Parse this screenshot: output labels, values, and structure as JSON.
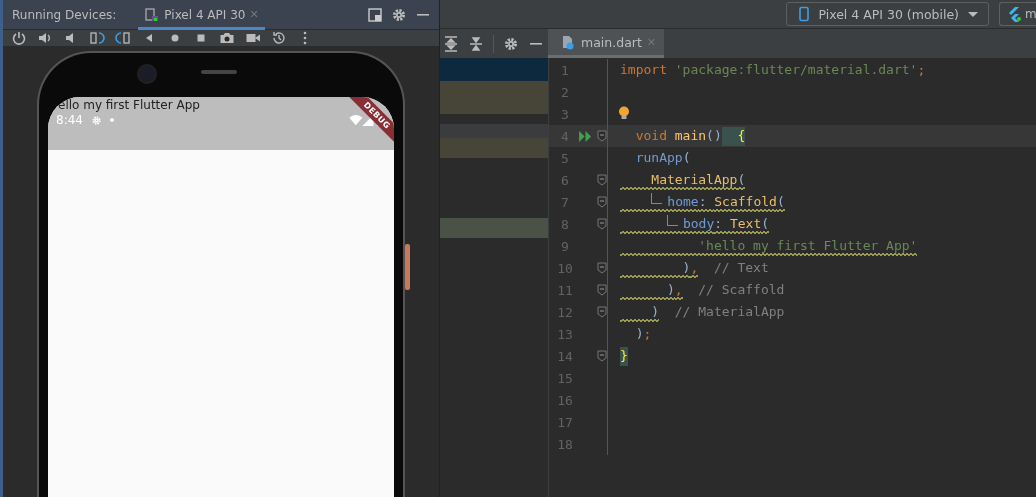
{
  "device_panel": {
    "title": "Running Devices:",
    "tabs": [
      {
        "label": "Pixel 4 API 30",
        "close": "✕",
        "selected": true
      }
    ]
  },
  "phone": {
    "app_title": "ello my first Flutter App",
    "status_time": "8:44",
    "banner": "DEBUG"
  },
  "run_bar": {
    "device": "Pixel 4 API 30 (mobile)",
    "app_button": "m"
  },
  "editor_tabs": [
    {
      "label": "main.dart",
      "close": "✕",
      "selected": true
    }
  ],
  "lines": [
    {
      "number": "1",
      "fold": false,
      "run": false,
      "bulb": false,
      "current": false,
      "tokens": [
        {
          "text": "import",
          "kind": "keyword",
          "guide": false,
          "warning": false
        },
        {
          "text": " 'package:flutter/material.dart'",
          "kind": "string",
          "guide": false,
          "warning": false
        },
        {
          "text": ";",
          "kind": "punct",
          "guide": false,
          "warning": false
        }
      ]
    },
    {
      "number": "2",
      "fold": false,
      "run": false,
      "bulb": false,
      "current": false
    },
    {
      "number": "3",
      "fold": false,
      "run": false,
      "bulb": true,
      "current": false
    },
    {
      "number": "4",
      "fold": true,
      "run": true,
      "bulb": false,
      "current": true,
      "tokens": [
        {
          "text": "  void",
          "kind": "keyword",
          "guide": false,
          "warning": false
        },
        {
          "text": " main",
          "kind": "function",
          "guide": false,
          "warning": false
        },
        {
          "text": "()",
          "kind": "paren",
          "guide": false,
          "warning": false
        },
        {
          "text": "  {",
          "kind": "brace",
          "guide": false,
          "warning": false
        }
      ]
    },
    {
      "number": "5",
      "fold": false,
      "run": false,
      "bulb": false,
      "current": false,
      "tokens": [
        {
          "text": "  runApp",
          "kind": "call",
          "guide": false,
          "warning": false
        },
        {
          "text": "(",
          "kind": "paren",
          "guide": false,
          "warning": false
        }
      ]
    },
    {
      "number": "6",
      "fold": true,
      "run": false,
      "bulb": false,
      "current": false,
      "tokens": [
        {
          "text": "    MaterialApp",
          "kind": "class",
          "guide": false,
          "warning": true
        },
        {
          "text": "(",
          "kind": "paren",
          "guide": false,
          "warning": true
        }
      ]
    },
    {
      "number": "7",
      "fold": true,
      "run": false,
      "bulb": false,
      "current": false,
      "tokens": [
        {
          "text": "    home",
          "kind": "call",
          "guide": true,
          "warning": true
        },
        {
          "text": ": ",
          "kind": "paren",
          "guide": false,
          "warning": true
        },
        {
          "text": "Scaffold",
          "kind": "class",
          "guide": false,
          "warning": true
        },
        {
          "text": "(",
          "kind": "paren",
          "guide": false,
          "warning": true
        }
      ]
    },
    {
      "number": "8",
      "fold": true,
      "run": false,
      "bulb": false,
      "current": false,
      "tokens": [
        {
          "text": "      body",
          "kind": "call",
          "guide": true,
          "warning": true
        },
        {
          "text": ": ",
          "kind": "paren",
          "guide": false,
          "warning": true
        },
        {
          "text": "Text",
          "kind": "class",
          "guide": false,
          "warning": true
        },
        {
          "text": "(",
          "kind": "paren",
          "guide": false,
          "warning": true
        }
      ]
    },
    {
      "number": "9",
      "fold": false,
      "run": false,
      "bulb": false,
      "current": false,
      "tokens": [
        {
          "text": "          'hello my first Flutter App'",
          "kind": "string",
          "guide": false,
          "warning": true
        }
      ]
    },
    {
      "number": "10",
      "fold": true,
      "run": false,
      "bulb": false,
      "current": false,
      "tokens": [
        {
          "text": "        )",
          "kind": "paren",
          "guide": false,
          "warning": true
        },
        {
          "text": ",",
          "kind": "punct",
          "guide": false,
          "warning": true
        },
        {
          "text": "  // Text",
          "kind": "comment",
          "guide": false,
          "warning": false
        }
      ]
    },
    {
      "number": "11",
      "fold": true,
      "run": false,
      "bulb": false,
      "current": false,
      "tokens": [
        {
          "text": "      )",
          "kind": "paren",
          "guide": false,
          "warning": true
        },
        {
          "text": ",",
          "kind": "punct",
          "guide": false,
          "warning": true
        },
        {
          "text": "  // Scaffold",
          "kind": "comment",
          "guide": false,
          "warning": false
        }
      ]
    },
    {
      "number": "12",
      "fold": true,
      "run": false,
      "bulb": false,
      "current": false,
      "tokens": [
        {
          "text": "    )",
          "kind": "paren",
          "guide": false,
          "warning": true
        },
        {
          "text": "  // MaterialApp",
          "kind": "comment",
          "guide": false,
          "warning": false
        }
      ]
    },
    {
      "number": "13",
      "fold": false,
      "run": false,
      "bulb": false,
      "current": false,
      "tokens": [
        {
          "text": "  )",
          "kind": "paren",
          "guide": false,
          "warning": false
        },
        {
          "text": ";",
          "kind": "punct",
          "guide": false,
          "warning": false
        }
      ]
    },
    {
      "number": "14",
      "fold": true,
      "run": false,
      "bulb": false,
      "current": false,
      "tokens": [
        {
          "text": "}",
          "kind": "brace",
          "guide": false,
          "warning": false
        }
      ]
    },
    {
      "number": "15",
      "fold": false,
      "run": false,
      "bulb": false,
      "current": false
    },
    {
      "number": "16",
      "fold": false,
      "run": false,
      "bulb": false,
      "current": false
    },
    {
      "number": "17",
      "fold": false,
      "run": false,
      "bulb": false,
      "current": false
    },
    {
      "number": "18",
      "fold": false,
      "run": false,
      "bulb": false,
      "current": false
    }
  ]
}
